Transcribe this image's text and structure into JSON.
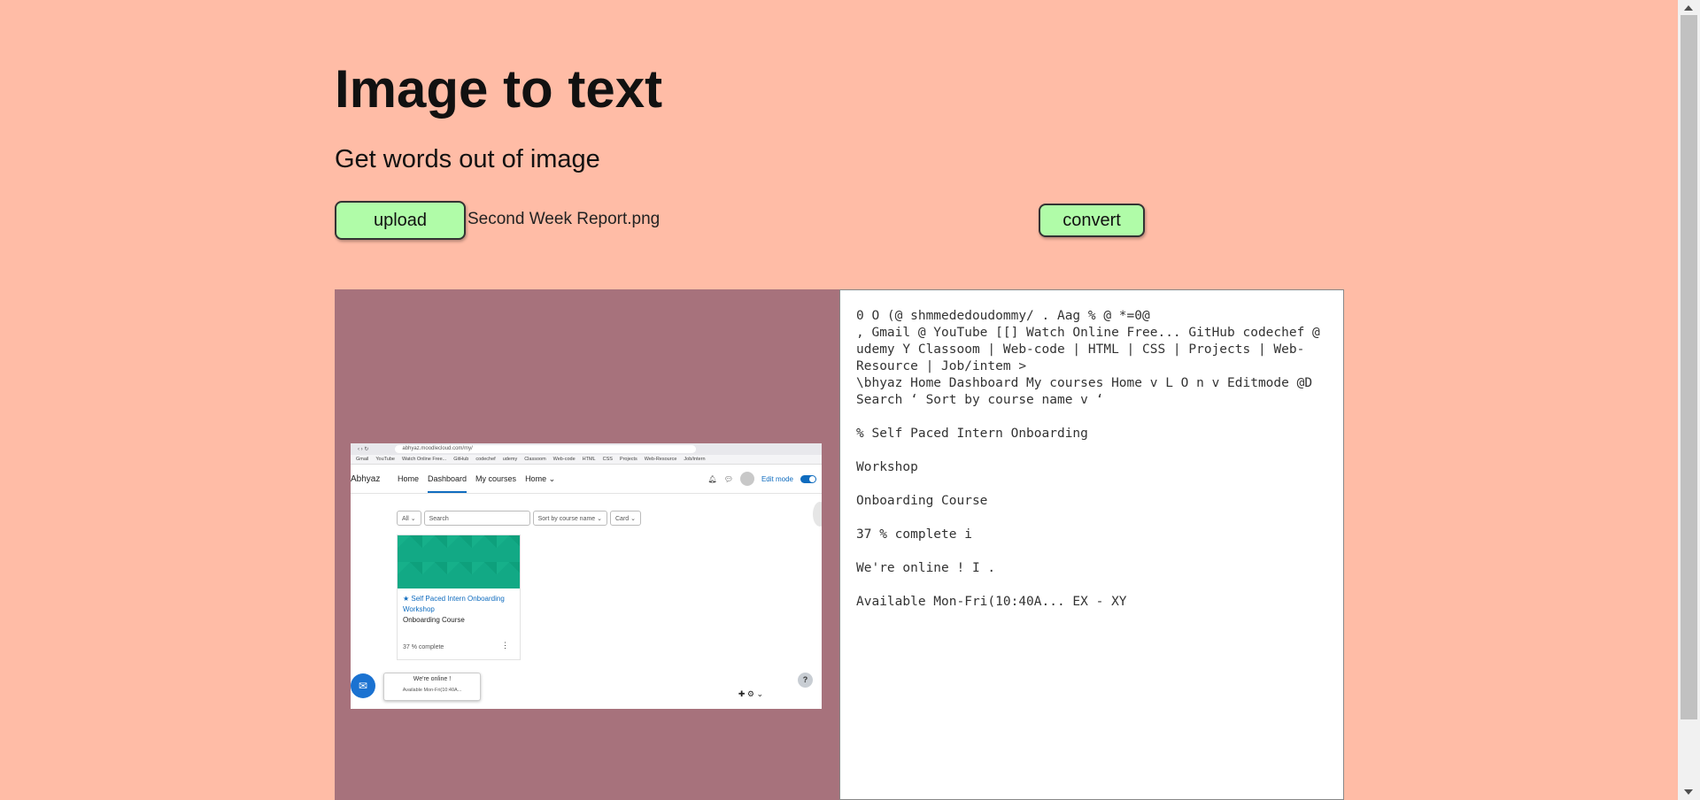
{
  "header": {
    "title": "Image to text",
    "subtitle": "Get words out of image"
  },
  "controls": {
    "upload_label": "upload",
    "filename": "Second Week Report.png",
    "convert_label": "convert"
  },
  "output": {
    "text": "0 O (@ shmmededoudommy/ . Aag % @ *=0@\n, Gmail @ YouTube [[] Watch Online Free... GitHub codechef @ udemy Y Classoom | Web-code | HTML | CSS | Projects | Web-Resource | Job/intem >\n\\bhyaz Home Dashboard My courses Home v L O n v Editmode @D Search ‘ Sort by course name v ‘\n\n% Self Paced Intern Onboarding\n\nWorkshop\n\nOnboarding Course\n\n37 % complete i\n\nWe're online ! I .\n\nAvailable Mon-Fri(10:40A... EX - XY"
  },
  "preview": {
    "url": "abhyaz.moodlecloud.com/my/",
    "bookmarks": [
      "Gmail",
      "YouTube",
      "Watch Online Free...",
      "GitHub",
      "codechef",
      "udemy",
      "Classoom",
      "Web-code",
      "HTML",
      "CSS",
      "Projects",
      "Web-Resource",
      "Job/intern"
    ],
    "brand": "Abhyaz",
    "nav": [
      "Home",
      "Dashboard",
      "My courses",
      "Home ⌄"
    ],
    "edit_mode": "Edit mode",
    "filter_all": "All ⌄",
    "search_placeholder": "Search",
    "sort": "Sort by course name ⌄",
    "view": "Card ⌄",
    "course_title": "★ Self Paced Intern Onboarding Workshop",
    "course_category": "Onboarding Course",
    "progress": "37 % complete",
    "chat_title": "We're online !",
    "chat_sub": "Available Mon-Fri(10:40A...",
    "help": "?"
  },
  "colors": {
    "background": "#ffbca6",
    "button": "#b0fca8",
    "image_panel": "#a7727c",
    "text_panel": "#ffffff"
  }
}
